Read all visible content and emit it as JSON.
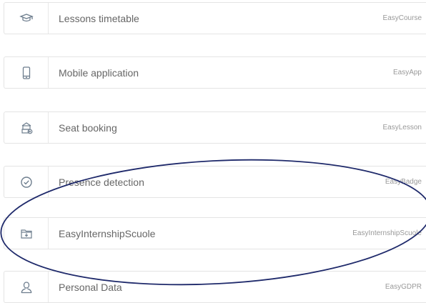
{
  "menu": {
    "items": [
      {
        "label": "Lessons timetable",
        "product": "EasyCourse",
        "icon": "graduation-cap-icon"
      },
      {
        "label": "Mobile application",
        "product": "EasyApp",
        "icon": "mobile-phone-icon"
      },
      {
        "label": "Seat booking",
        "product": "EasyLesson",
        "icon": "seat-booking-icon"
      },
      {
        "label": "Presence detection",
        "product": "EasyBadge",
        "icon": "check-circle-icon"
      },
      {
        "label": "EasyInternshipScuole",
        "product": "EasyInternshipScuole",
        "icon": "folder-icon"
      },
      {
        "label": "Personal Data",
        "product": "EasyGDPR",
        "icon": "user-icon"
      }
    ]
  },
  "colors": {
    "icon": "#6e7e8e",
    "label": "#666666",
    "product": "#999999",
    "border": "#e4e4e4",
    "annotation": "#1f2a6b"
  }
}
